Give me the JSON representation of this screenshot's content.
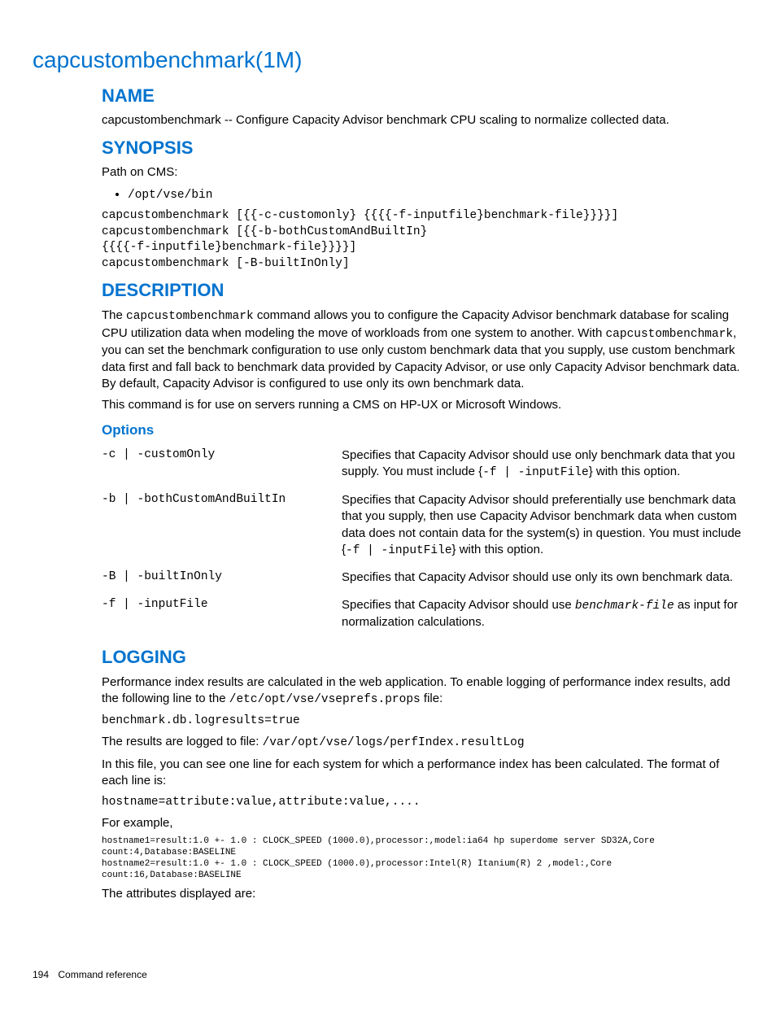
{
  "page_title": "capcustombenchmark(1M)",
  "sections": {
    "name": {
      "heading": "NAME",
      "text": "capcustombenchmark -- Configure Capacity Advisor benchmark CPU scaling to normalize collected data."
    },
    "synopsis": {
      "heading": "SYNOPSIS",
      "path_label": "Path on CMS:",
      "path_value": "/opt/vse/bin",
      "lines": "capcustombenchmark [{{-c-customonly} {{{{-f-inputfile}benchmark-file}}}}]\ncapcustombenchmark [{{-b-bothCustomAndBuiltIn}\n{{{{-f-inputfile}benchmark-file}}}}]\ncapcustombenchmark [-B-builtInOnly]"
    },
    "description": {
      "heading": "DESCRIPTION",
      "para1_a": "The ",
      "para1_cmd1": "capcustombenchmark",
      "para1_b": " command allows you to configure the Capacity Advisor benchmark database for scaling CPU utilization data when modeling the move of workloads from one system to another. With ",
      "para1_cmd2": "capcustombenchmark",
      "para1_c": ", you can set the benchmark configuration to use only custom benchmark data that you supply, use custom benchmark data first and fall back to benchmark data provided by Capacity Advisor, or use only Capacity Advisor benchmark data. By default, Capacity Advisor is configured to use only its own benchmark data.",
      "para2": "This command is for use on servers running a CMS on HP-UX or Microsoft Windows."
    },
    "options": {
      "heading": "Options",
      "rows": [
        {
          "flag": "-c | -customOnly",
          "desc_a": "Specifies that Capacity Advisor should use only benchmark data that you supply. You must include {",
          "desc_code": "-f | -inputFile",
          "desc_b": "} with this option."
        },
        {
          "flag": "-b | -bothCustomAndBuiltIn",
          "desc_a": "Specifies that Capacity Advisor should preferentially use benchmark data that you supply, then use Capacity Advisor benchmark data when custom data does not contain data for the system(s) in question. You must include {",
          "desc_code": "-f | -inputFile",
          "desc_b": "} with this option."
        },
        {
          "flag": "-B | -builtInOnly",
          "desc_a": "Specifies that Capacity Advisor should use only its own benchmark data.",
          "desc_code": "",
          "desc_b": ""
        },
        {
          "flag": "-f | -inputFile",
          "desc_a": "Specifies that Capacity Advisor should use ",
          "desc_code_italic": "benchmark-file",
          "desc_b": " as input for normalization calculations."
        }
      ]
    },
    "logging": {
      "heading": "LOGGING",
      "p1_a": "Performance index results are calculated in the web application. To enable logging of performance index results, add the following line to the ",
      "p1_code": "/etc/opt/vse/vseprefs.props",
      "p1_b": " file:",
      "code1": "benchmark.db.logresults=true",
      "p2_a": "The results are logged to file: ",
      "p2_code": "/var/opt/vse/logs/perfIndex.resultLog",
      "p3": "In this file, you can see one line for each system for which a performance index has been calculated. The format of each line is:",
      "code2": "hostname=attribute:value,attribute:value,....",
      "p4": "For example,",
      "example": "hostname1=result:1.0 +- 1.0 : CLOCK_SPEED (1000.0),processor:,model:ia64 hp superdome server SD32A,Core count:4,Database:BASELINE\nhostname2=result:1.0 +- 1.0 : CLOCK_SPEED (1000.0),processor:Intel(R) Itanium(R) 2 ,model:,Core count:16,Database:BASELINE",
      "p5": "The attributes displayed are:"
    }
  },
  "footer": {
    "page_number": "194",
    "section": "Command reference"
  }
}
